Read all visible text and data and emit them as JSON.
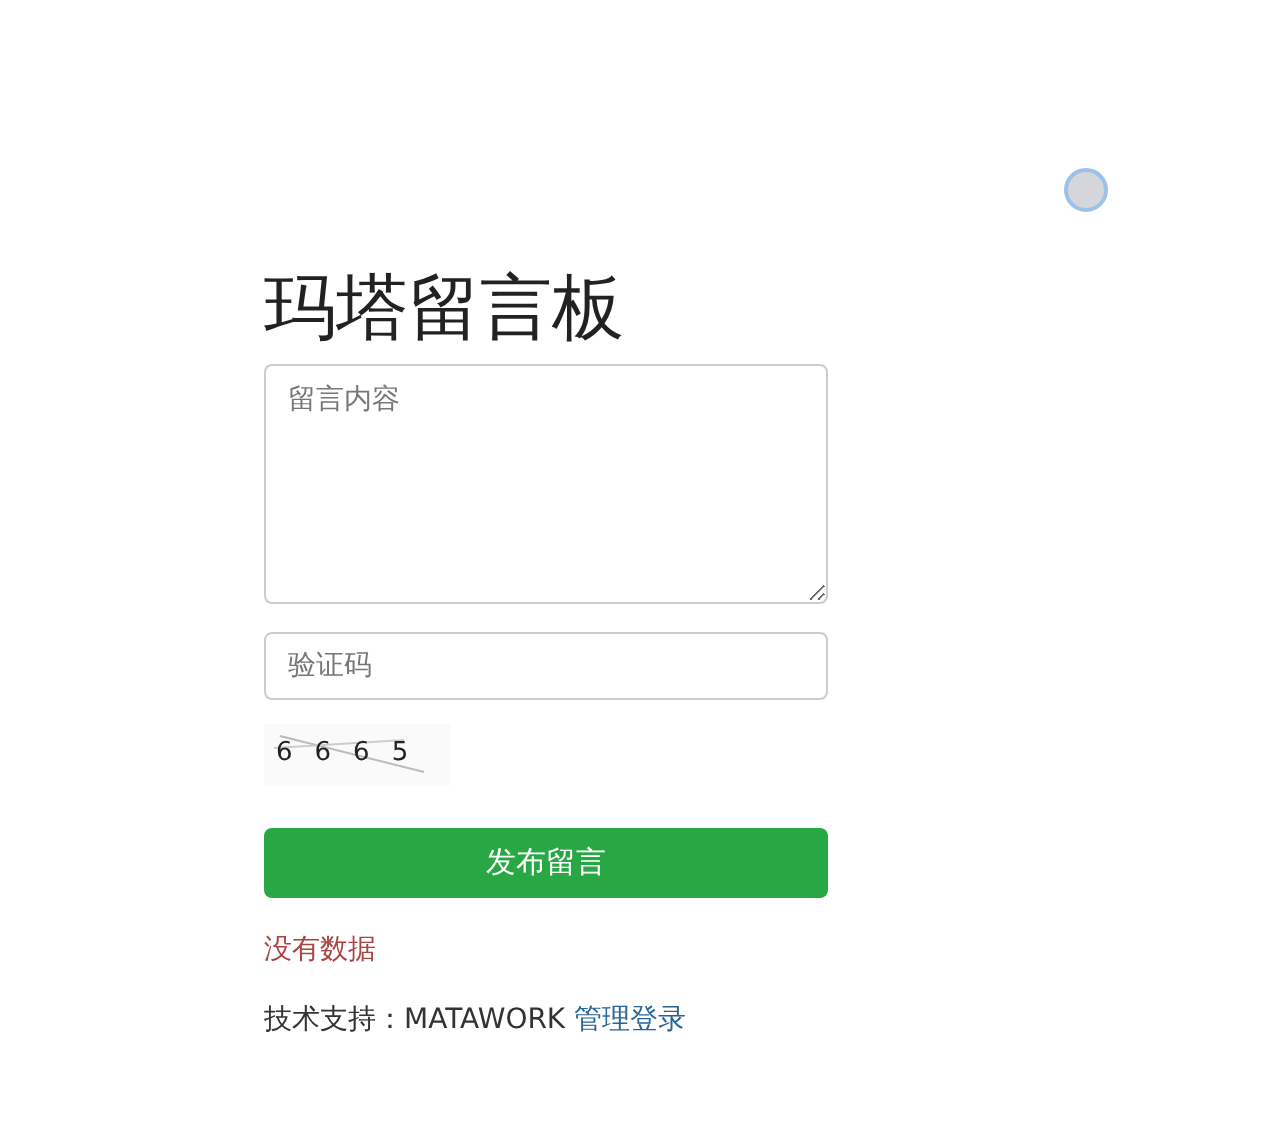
{
  "title": "玛塔留言板",
  "message_field": {
    "placeholder": "留言内容"
  },
  "captcha_field": {
    "placeholder": "验证码"
  },
  "captcha_image": {
    "text": "6665"
  },
  "submit_button": {
    "label": "发布留言"
  },
  "empty_notice": "没有数据",
  "footer": {
    "text": "技术支持：MATAWORK",
    "link": "管理登录"
  }
}
